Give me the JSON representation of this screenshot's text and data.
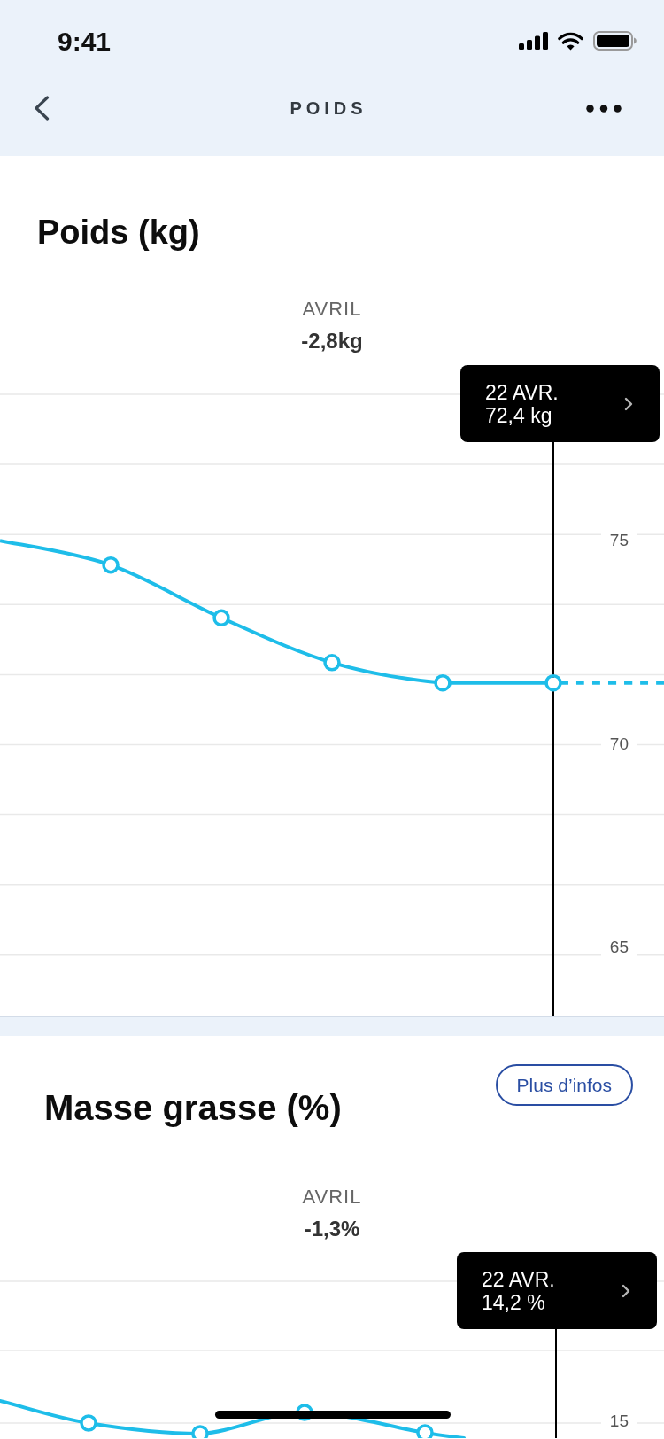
{
  "status_bar": {
    "time": "9:41"
  },
  "nav_bar": {
    "title": "POIDS"
  },
  "weight_section": {
    "title": "Poids (kg)",
    "period": "AVRIL",
    "change": "-2,8kg",
    "tooltip": {
      "date": "22 AVR.",
      "value": "72,4 kg"
    },
    "chart_data": {
      "type": "line",
      "categories": [
        null,
        null,
        null,
        null,
        null,
        null,
        null
      ],
      "ylim": [
        52.9,
        88.3
      ],
      "yticks": [
        75,
        70,
        65
      ],
      "series": [
        {
          "color": "#1ebde9",
          "line_style": "solid",
          "marker": "circle",
          "values": [
            75,
            74.4,
            73.1,
            72,
            71.5,
            71.5,
            null
          ]
        },
        {
          "color": "#1ebde9",
          "line_style": "dashed",
          "marker": "none",
          "values": [
            null,
            null,
            null,
            null,
            null,
            71.5,
            71.5
          ]
        }
      ]
    }
  },
  "fat_section": {
    "title": "Masse grasse (%)",
    "button": "Plus d’infos",
    "period": "AVRIL",
    "change": "-1,3%",
    "tooltip": {
      "date": "22 AVR.",
      "value": "14,2 %"
    },
    "y_axis_labels": [
      "15"
    ]
  }
}
